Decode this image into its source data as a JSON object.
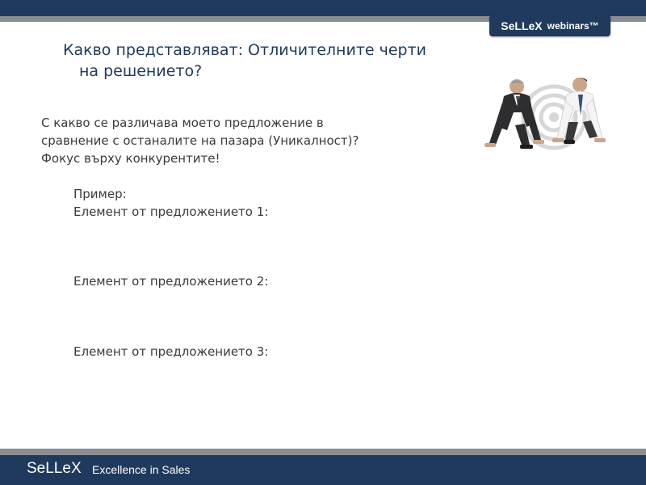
{
  "header": {
    "badge_brand": "SeLLeX",
    "badge_suffix": "webinars™"
  },
  "slide": {
    "title_line1": "Какво представляват: Отличителните черти",
    "title_line2": "на решението?",
    "body_line1": "С какво се различава моето предложение в",
    "body_line2": "сравнение с останалите на пазара (Уникалност)?",
    "body_line3": "Фокус върху конкурентите!",
    "example_label": "Пример:",
    "element_1": "Елемент от предложението 1:",
    "element_2": "Елемент от предложението 2:",
    "element_3": "Елемент от предложението 3:"
  },
  "footer": {
    "brand": "SeLLeX",
    "tagline": "Excellence in Sales"
  },
  "colors": {
    "navy": "#1f3a5c",
    "stripe_gray": "#8a8d91",
    "text_gray": "#3a3a3a"
  },
  "icons": [
    "businessmen-starting-line-illustration"
  ]
}
